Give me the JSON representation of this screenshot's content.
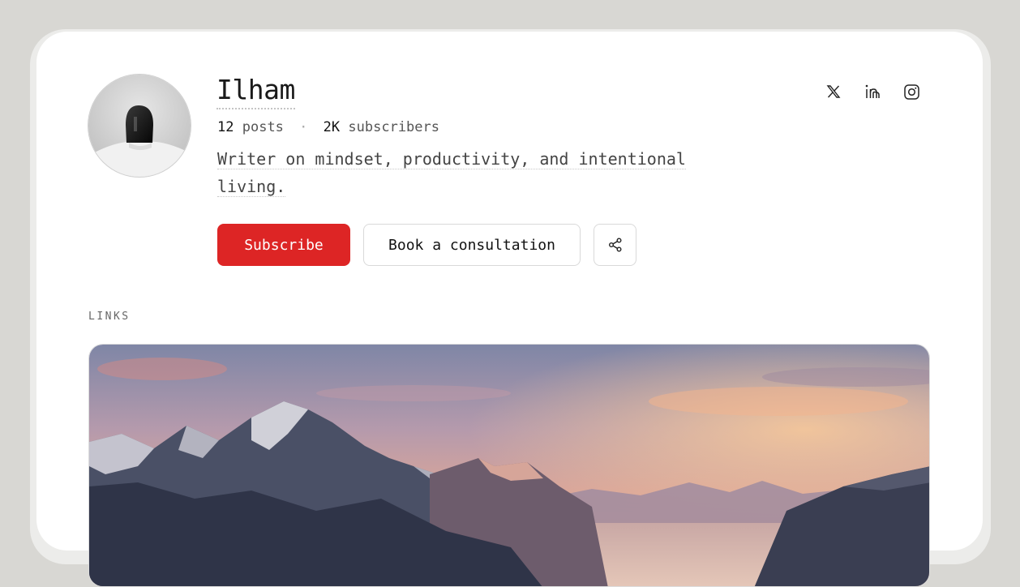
{
  "profile": {
    "name": "Ilham",
    "posts_count": "12",
    "posts_label": "posts",
    "subscribers_count": "2K",
    "subscribers_label": "subscribers",
    "separator": "·",
    "bio": "Writer on mindset, productivity, and intentional living.",
    "avatar_icon": "avatar-image"
  },
  "actions": {
    "subscribe_label": "Subscribe",
    "book_label": "Book a consultation",
    "share_icon": "share-icon"
  },
  "socials": [
    {
      "name": "x-icon"
    },
    {
      "name": "linkedin-icon"
    },
    {
      "name": "instagram-icon"
    }
  ],
  "links": {
    "section_label": "LINKS",
    "banner_icon": "mountain-landscape-image"
  },
  "colors": {
    "accent": "#dd2525",
    "background": "#d8d7d3",
    "card": "#ffffff"
  }
}
